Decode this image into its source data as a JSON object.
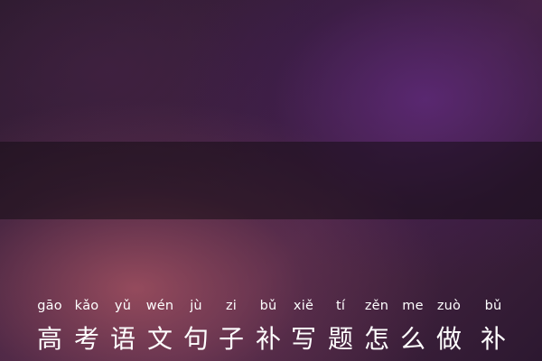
{
  "title_pinyin": [
    "gāo",
    "kǎo",
    "yǔ",
    "wén",
    "jù",
    "zi",
    "bǔ",
    "xiě",
    "tí",
    "zěn",
    "me",
    "zuò",
    "bǔ"
  ],
  "title_hanzi": [
    "高",
    "考",
    "语",
    "文",
    "句",
    "子",
    "补",
    "写",
    "题",
    "怎",
    "么",
    "做",
    "补"
  ]
}
